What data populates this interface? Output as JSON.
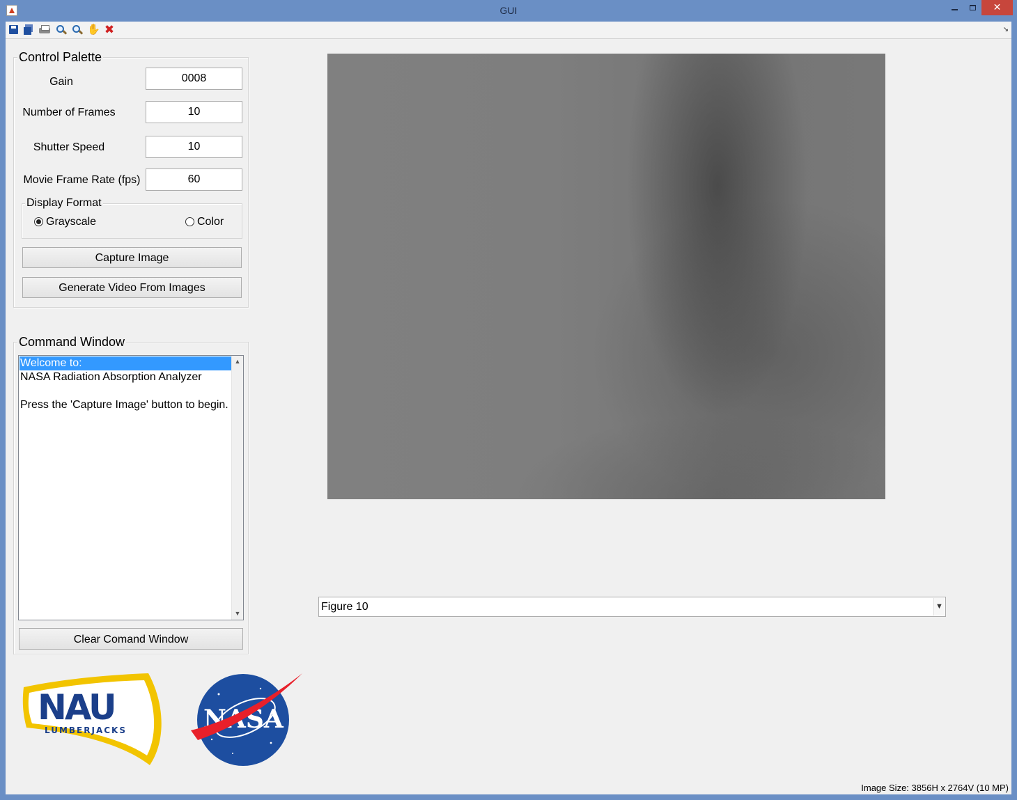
{
  "window": {
    "title": "GUI",
    "close_glyph": "✕",
    "icon": "matlab-icon"
  },
  "toolbar": {
    "icons": [
      "save-icon",
      "save-all-icon",
      "print-icon",
      "zoom-in-icon",
      "zoom-out-icon",
      "pan-icon",
      "delete-icon"
    ],
    "pan_glyph": "✋",
    "delete_glyph": "✖",
    "dock_glyph": "↘"
  },
  "control_palette": {
    "title": "Control Palette",
    "gain_label": "Gain",
    "gain_value": "0008",
    "frames_label": "Number of Frames",
    "frames_value": "10",
    "shutter_label": "Shutter Speed",
    "shutter_value": "10",
    "framerate_label": "Movie Frame Rate (fps)",
    "framerate_value": "60",
    "display_format": {
      "title": "Display Format",
      "options": [
        "Grayscale",
        "Color"
      ],
      "selected": "Grayscale"
    },
    "capture_button": "Capture Image",
    "video_button": "Generate Video From Images"
  },
  "command_window": {
    "title": "Command Window",
    "lines": [
      "Welcome to:",
      "NASA Radiation Absorption Analyzer",
      "",
      "Press the 'Capture Image' button to begin."
    ],
    "selected_line": 0,
    "clear_button": "Clear Comand Window",
    "scroll_up": "▲",
    "scroll_down": "▼"
  },
  "figure_select": {
    "value": "Figure 10",
    "arrow": "▼"
  },
  "status": {
    "image_size": "Image Size: 3856H x 2764V (10 MP)"
  },
  "logos": {
    "nau_text": "NAU",
    "nau_sub": "LUMBERJACKS",
    "nasa_text": "NASA"
  },
  "colors": {
    "title_bar": "#6a8fc5",
    "selection": "#3399ff",
    "close": "#c7463c",
    "nau_gold": "#f2c400",
    "nau_blue": "#1b3f8a",
    "nasa_blue": "#1d4ea0",
    "nasa_red": "#e8202a"
  }
}
